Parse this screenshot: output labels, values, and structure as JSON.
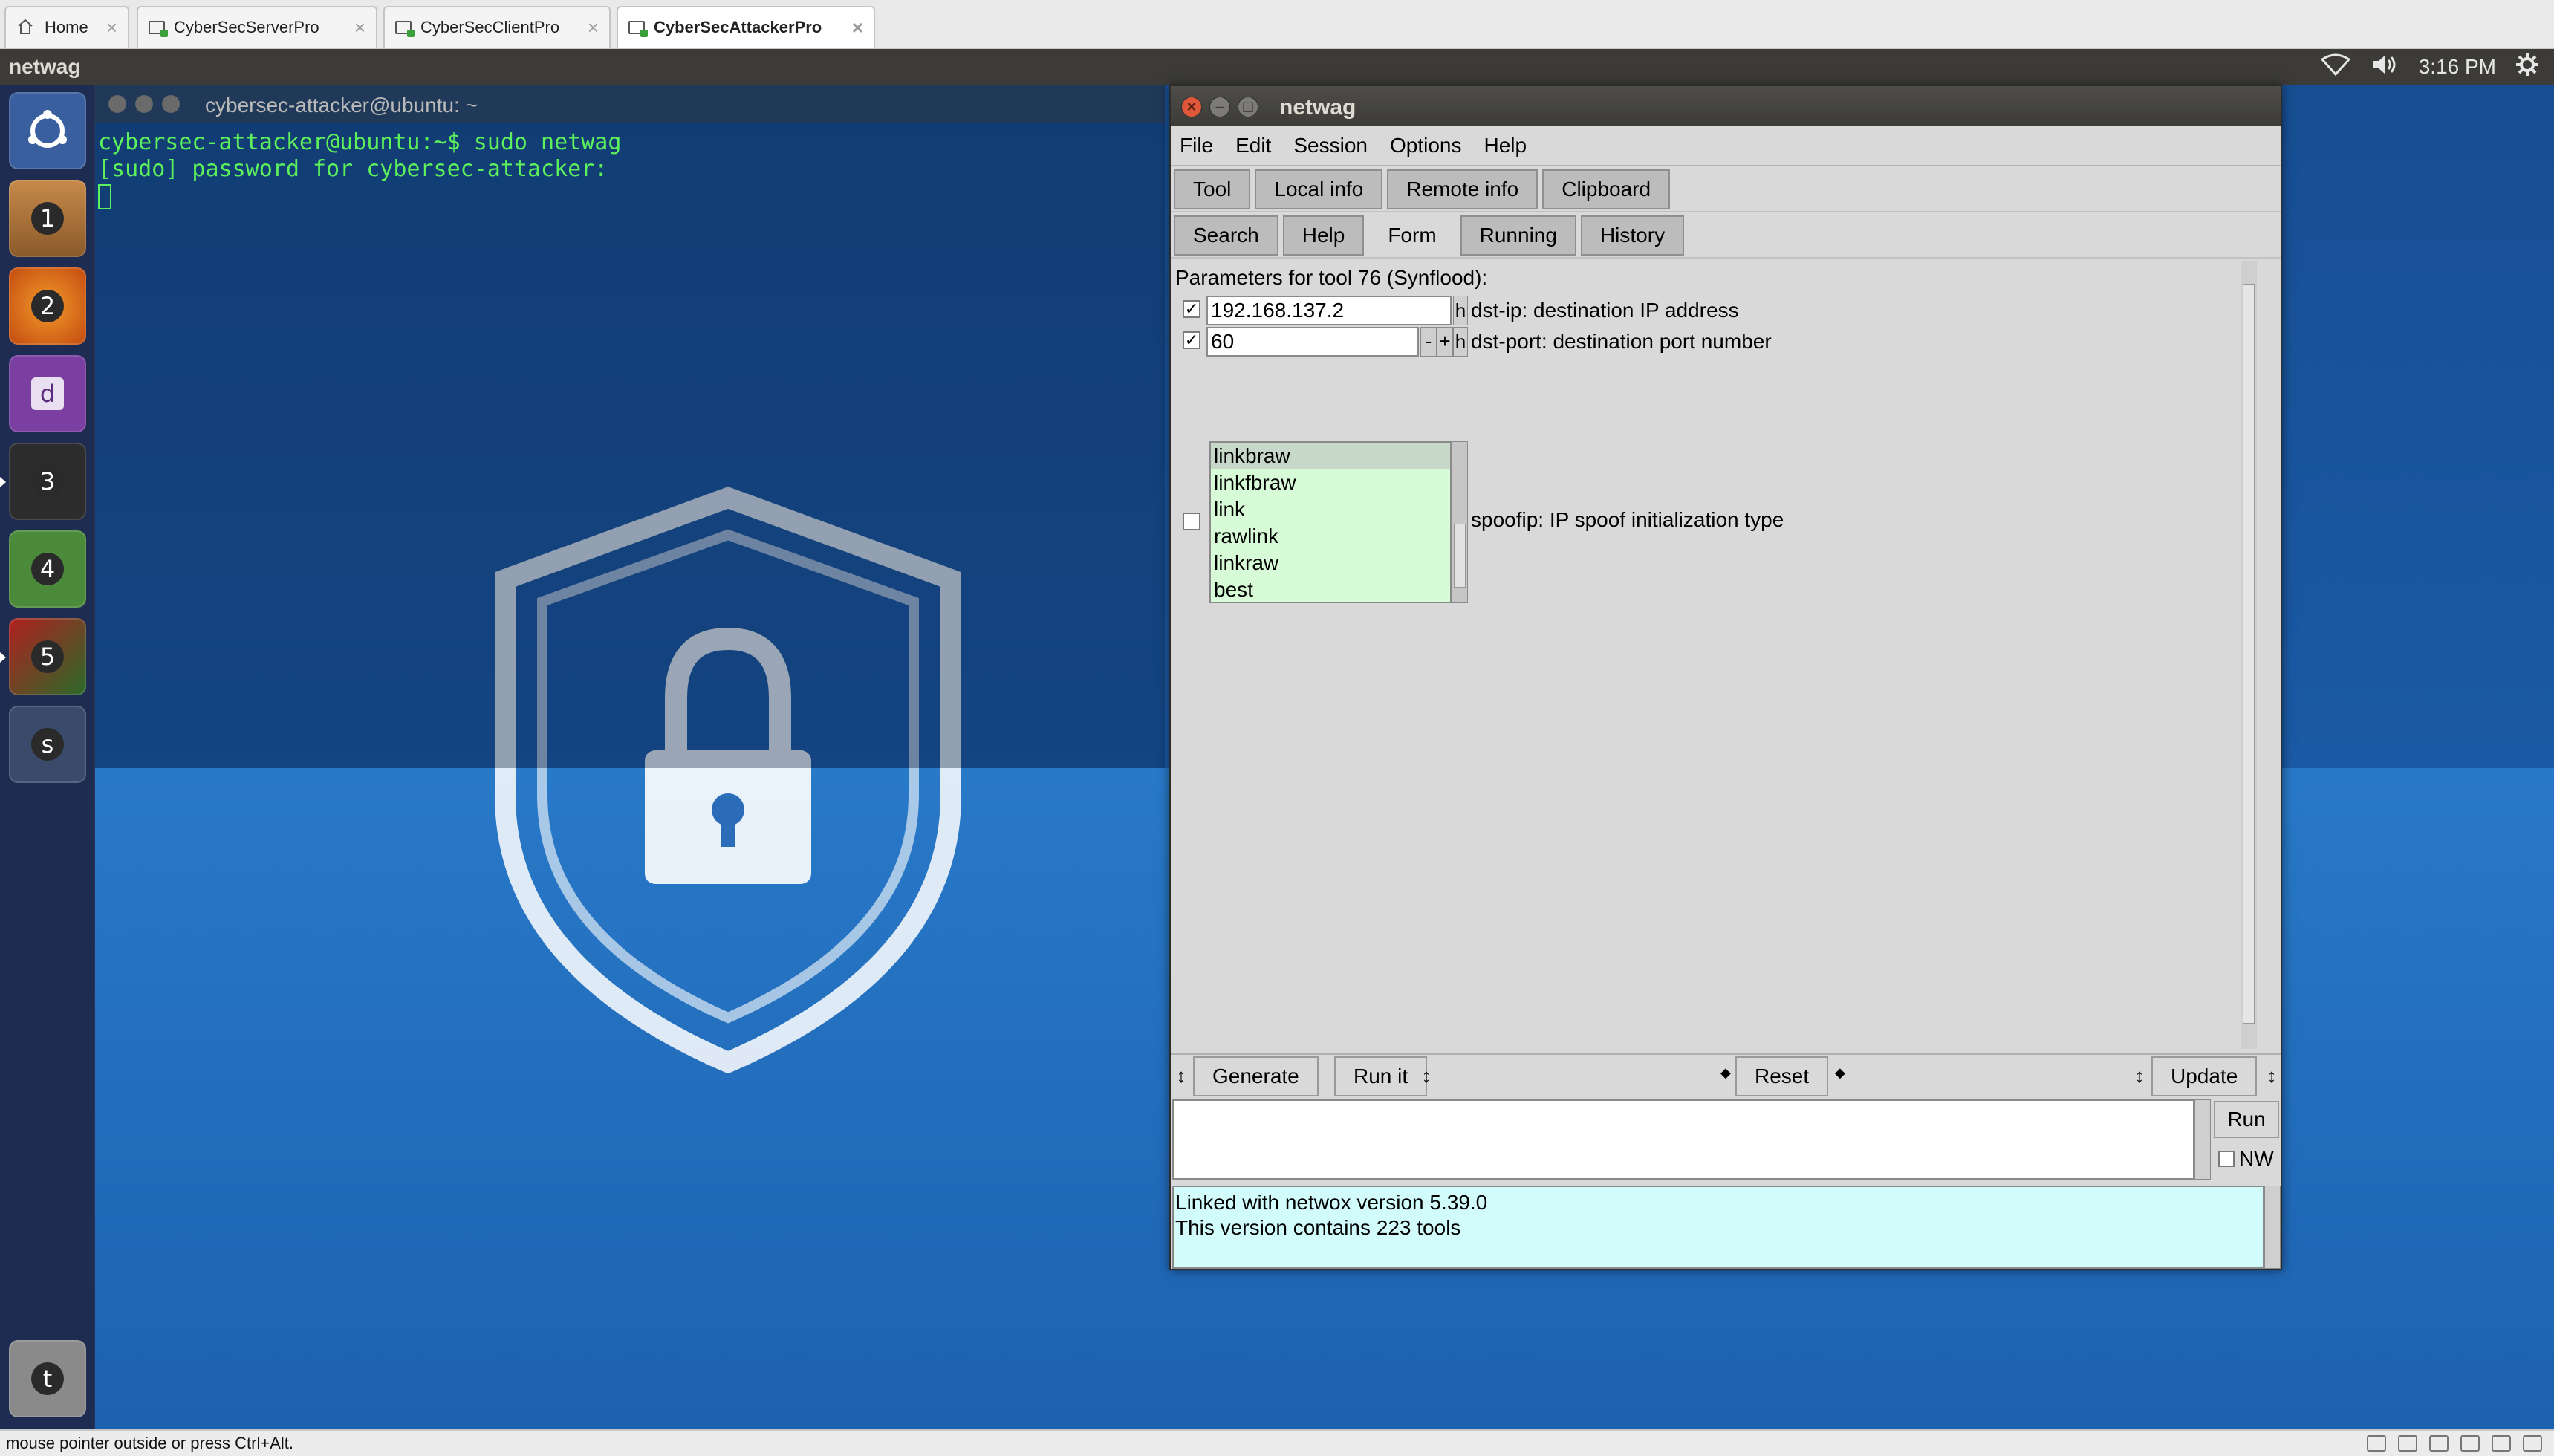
{
  "host_tabs": [
    {
      "label": "Home",
      "icon": "home-icon"
    },
    {
      "label": "CyberSecServerPro",
      "icon": "vm-icon"
    },
    {
      "label": "CyberSecClientPro",
      "icon": "vm-icon"
    },
    {
      "label": "CyberSecAttackerPro",
      "icon": "vm-icon",
      "active": true
    }
  ],
  "top_panel": {
    "app_name": "netwag",
    "clock": "3:16 PM",
    "tray_icons": [
      "wifi-icon",
      "volume-icon",
      "settings-gear-icon"
    ]
  },
  "launcher": {
    "items": [
      {
        "name": "ubuntu-dash",
        "icon": "ubuntu-logo-icon"
      },
      {
        "name": "files",
        "number": "1"
      },
      {
        "name": "firefox",
        "number": "2"
      },
      {
        "name": "dash-app",
        "number": "d"
      },
      {
        "name": "terminal",
        "number": "3"
      },
      {
        "name": "software-updater",
        "number": "4"
      },
      {
        "name": "wireshark",
        "number": "5"
      },
      {
        "name": "workspace-switcher",
        "number": "s"
      },
      {
        "name": "trash",
        "number": "t"
      }
    ]
  },
  "terminal": {
    "title": "cybersec-attacker@ubuntu: ~",
    "line1": "cybersec-attacker@ubuntu:~$ sudo netwag",
    "line2": "[sudo] password for cybersec-attacker:"
  },
  "netwag": {
    "title": "netwag",
    "menu": [
      "File",
      "Edit",
      "Session",
      "Options",
      "Help"
    ],
    "tabs_row1": [
      "Tool",
      "Local info",
      "Remote info",
      "Clipboard"
    ],
    "tabs_row2": [
      "Search",
      "Help",
      "Form",
      "Running",
      "History"
    ],
    "selected_row2": "Form",
    "params_label": "Parameters for tool 76 (Synflood):",
    "params": {
      "dst_ip": {
        "checked": true,
        "value": "192.168.137.2",
        "h": "h",
        "desc": "dst-ip: destination IP address"
      },
      "dst_port": {
        "checked": true,
        "value": "60",
        "minus": "-",
        "plus": "+",
        "h": "h",
        "desc": "dst-port: destination port number"
      },
      "spoofip": {
        "checked": false,
        "desc": "spoofip: IP spoof initialization type",
        "options": [
          "linkbraw",
          "linkfbraw",
          "link",
          "rawlink",
          "linkraw",
          "best"
        ],
        "selected": "linkbraw"
      }
    },
    "buttons": {
      "generate": "Generate",
      "run_it": "Run it",
      "reset": "Reset",
      "update": "Update",
      "run": "Run",
      "nw": "NW"
    },
    "info_line1": "Linked with netwox version 5.39.0",
    "info_line2": "This version contains 223 tools"
  },
  "statusbar": {
    "text": "mouse pointer outside or press Ctrl+Alt."
  }
}
